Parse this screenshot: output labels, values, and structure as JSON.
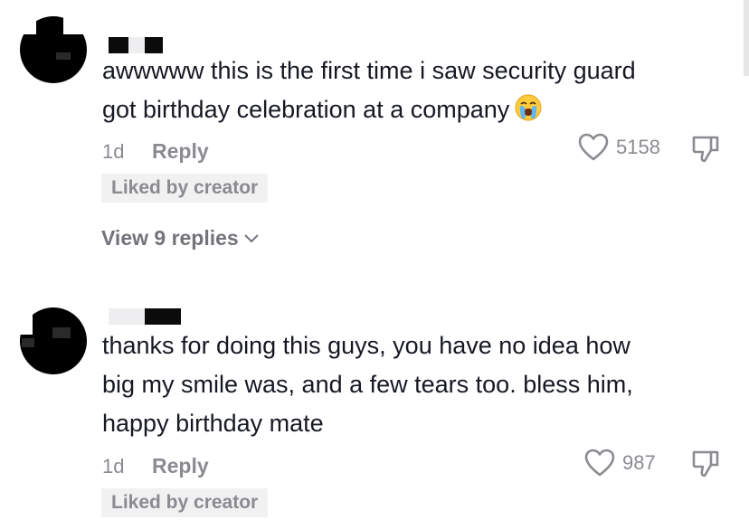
{
  "comments": [
    {
      "text": "awwwww this is the first time i saw security guard\ngot birthday celebration at a company",
      "emoji": "loudly-crying-face",
      "time": "1d",
      "reply_label": "Reply",
      "likes": "5158",
      "badge": "Liked by creator",
      "view_replies": "View 9 replies"
    },
    {
      "text": "thanks for doing this guys, you have no idea how\nbig my smile was, and a few tears too. bless him,\nhappy birthday mate",
      "time": "1d",
      "reply_label": "Reply",
      "likes": "987",
      "badge": "Liked by creator"
    }
  ],
  "icons": {
    "like": "heart-outline-icon",
    "dislike": "thumbs-down-icon",
    "expand": "chevron-down-icon"
  },
  "colors": {
    "text": "#161823",
    "meta": "#8a8b91",
    "badge_bg": "#f1f1f2"
  }
}
